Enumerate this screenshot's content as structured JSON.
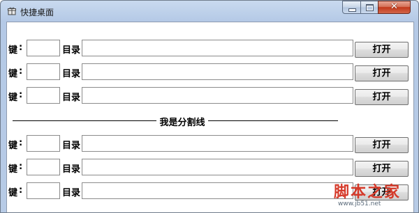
{
  "window": {
    "title": "快捷桌面",
    "app_icon": "gift-box-icon",
    "caption_buttons": {
      "minimize_icon": "minimize-icon",
      "maximize_icon": "maximize-icon",
      "close_label": "✕"
    }
  },
  "labels": {
    "key": "键",
    "colon": ":",
    "directory": "目录",
    "open_button": "打开",
    "divider": "我是分割线"
  },
  "rows_top": [
    {
      "key": "",
      "dir": ""
    },
    {
      "key": "",
      "dir": ""
    },
    {
      "key": "",
      "dir": ""
    }
  ],
  "rows_bottom": [
    {
      "key": "",
      "dir": ""
    },
    {
      "key": "",
      "dir": ""
    },
    {
      "key": "",
      "dir": ""
    }
  ],
  "watermark": {
    "main": "脚本之家",
    "sub": "www.jb51.net"
  },
  "colors": {
    "frame": "#b4c9e6",
    "close_button": "#c2391b",
    "watermark": "#d53a2a"
  }
}
